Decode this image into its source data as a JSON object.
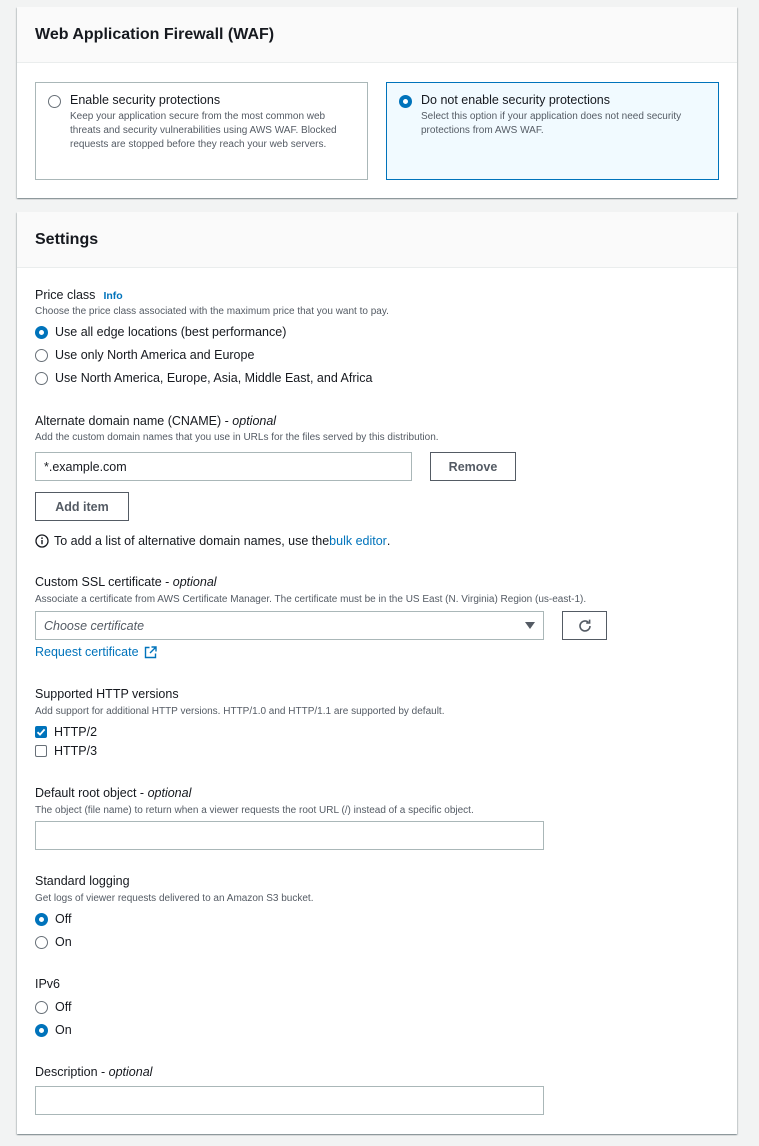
{
  "waf": {
    "title": "Web Application Firewall (WAF)",
    "options": [
      {
        "title": "Enable security protections",
        "desc": "Keep your application secure from the most common web threats and security vulnerabilities using AWS WAF. Blocked requests are stopped before they reach your web servers.",
        "selected": false
      },
      {
        "title": "Do not enable security protections",
        "desc": "Select this option if your application does not need security protections from AWS WAF.",
        "selected": true
      }
    ]
  },
  "settings": {
    "title": "Settings",
    "price_class": {
      "label": "Price class",
      "info": "Info",
      "desc": "Choose the price class associated with the maximum price that you want to pay.",
      "options": [
        "Use all edge locations (best performance)",
        "Use only North America and Europe",
        "Use North America, Europe, Asia, Middle East, and Africa"
      ],
      "selected_index": 0
    },
    "cname": {
      "label": "Alternate domain name (CNAME) - ",
      "optional": "optional",
      "desc": "Add the custom domain names that you use in URLs for the files served by this distribution.",
      "value": "*.example.com",
      "remove_label": "Remove",
      "add_label": "Add item",
      "hint_prefix": "To add a list of alternative domain names, use the ",
      "hint_link": "bulk editor",
      "hint_suffix": "."
    },
    "ssl": {
      "label": "Custom SSL certificate - ",
      "optional": "optional",
      "desc": "Associate a certificate from AWS Certificate Manager. The certificate must be in the US East (N. Virginia) Region (us-east-1).",
      "placeholder": "Choose certificate",
      "request_link": "Request certificate"
    },
    "http": {
      "label": "Supported HTTP versions",
      "desc": "Add support for additional HTTP versions. HTTP/1.0 and HTTP/1.1 are supported by default.",
      "options": [
        {
          "label": "HTTP/2",
          "checked": true
        },
        {
          "label": "HTTP/3",
          "checked": false
        }
      ]
    },
    "root_object": {
      "label": "Default root object - ",
      "optional": "optional",
      "desc": "The object (file name) to return when a viewer requests the root URL (/) instead of a specific object.",
      "value": ""
    },
    "logging": {
      "label": "Standard logging",
      "desc": "Get logs of viewer requests delivered to an Amazon S3 bucket.",
      "options": [
        "Off",
        "On"
      ],
      "selected_index": 0
    },
    "ipv6": {
      "label": "IPv6",
      "options": [
        "Off",
        "On"
      ],
      "selected_index": 1
    },
    "description": {
      "label": "Description - ",
      "optional": "optional",
      "value": ""
    }
  },
  "colors": {
    "accent": "#0073bb",
    "selected_tile_bg": "#f1faff",
    "border": "#aab7b8",
    "page_bg": "#f2f3f3"
  }
}
